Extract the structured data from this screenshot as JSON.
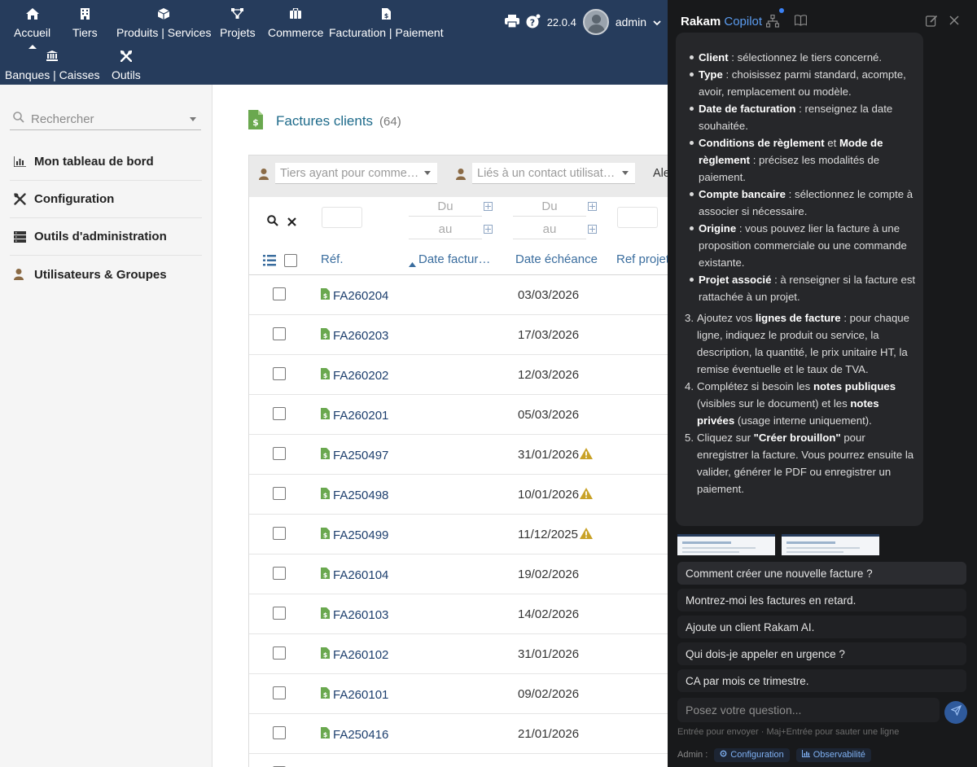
{
  "topnav": {
    "items": [
      {
        "label": "Accueil",
        "icon": "home-icon"
      },
      {
        "label": "Tiers",
        "icon": "building-icon"
      },
      {
        "label": "Produits | Services",
        "icon": "cube-icon"
      },
      {
        "label": "Projets",
        "icon": "project-icon"
      },
      {
        "label": "Commerce",
        "icon": "briefcase-icon"
      },
      {
        "label": "Facturation | Paiement",
        "icon": "invoice-icon"
      },
      {
        "label": "Banques | Caisses",
        "icon": "bank-icon"
      },
      {
        "label": "Outils",
        "icon": "tools-icon"
      }
    ],
    "version": "22.0.4",
    "user": "admin"
  },
  "sidebar": {
    "search_placeholder": "Rechercher",
    "items": [
      {
        "label": "Mon tableau de bord",
        "icon": "chart-bar-icon"
      },
      {
        "label": "Configuration",
        "icon": "tools-icon"
      },
      {
        "label": "Outils d'administration",
        "icon": "server-icon"
      },
      {
        "label": "Utilisateurs & Groupes",
        "icon": "user-icon"
      }
    ]
  },
  "main": {
    "title": "Factures clients",
    "count": "(64)",
    "filters": {
      "tiers_placeholder": "Tiers ayant pour comme…",
      "contact_placeholder": "Liés à un contact utilisat…",
      "extra_label": "Ale",
      "date_from": "Du",
      "date_to": "au"
    },
    "columns": {
      "ref": "Réf.",
      "date": "Date factur…",
      "due": "Date échéance",
      "project": "Ref projet"
    },
    "rows": [
      {
        "ref": "FA260204",
        "due": "03/03/2026",
        "late": false
      },
      {
        "ref": "FA260203",
        "due": "17/03/2026",
        "late": false
      },
      {
        "ref": "FA260202",
        "due": "12/03/2026",
        "late": false
      },
      {
        "ref": "FA260201",
        "due": "05/03/2026",
        "late": false
      },
      {
        "ref": "FA250497",
        "due": "31/01/2026",
        "late": true
      },
      {
        "ref": "FA250498",
        "due": "10/01/2026",
        "late": true
      },
      {
        "ref": "FA250499",
        "due": "11/12/2025",
        "late": true
      },
      {
        "ref": "FA260104",
        "due": "19/02/2026",
        "late": false
      },
      {
        "ref": "FA260103",
        "due": "14/02/2026",
        "late": false
      },
      {
        "ref": "FA260102",
        "due": "31/01/2026",
        "late": false
      },
      {
        "ref": "FA260101",
        "due": "09/02/2026",
        "late": false
      },
      {
        "ref": "FA250416",
        "due": "21/01/2026",
        "late": false
      }
    ]
  },
  "copilot": {
    "title_brand": "Rakam",
    "title_accent": "Copilot",
    "bullets": [
      {
        "term": "Client",
        "text": " : sélectionnez le tiers concerné."
      },
      {
        "term": "Type",
        "text": " : choisissez parmi standard, acompte, avoir, remplacement ou modèle."
      },
      {
        "term": "Date de facturation",
        "text": " : renseignez la date souhaitée."
      },
      {
        "term": "Conditions de règlement",
        "mid": " et ",
        "term2": "Mode de règlement",
        "text": " : précisez les modalités de paiement."
      },
      {
        "term": "Compte bancaire",
        "text": " : sélectionnez le compte à associer si nécessaire."
      },
      {
        "term": "Origine",
        "text": " : vous pouvez lier la facture à une proposition commerciale ou une commande existante."
      },
      {
        "term": "Projet associé",
        "text": " : à renseigner si la facture est rattachée à un projet."
      }
    ],
    "steps": [
      {
        "num": "3.",
        "pre": "Ajoutez vos ",
        "term": "lignes de facture",
        "text": " : pour chaque ligne, indiquez le produit ou service, la description, la quantité, le prix unitaire HT, la remise éventuelle et le taux de TVA."
      },
      {
        "num": "4.",
        "pre": "Complétez si besoin les ",
        "term": "notes publiques",
        "mid": " (visibles sur le document) et les ",
        "term2": "notes privées",
        "text": " (usage interne uniquement)."
      },
      {
        "num": "5.",
        "pre": "Cliquez sur ",
        "term": "\"Créer brouillon\"",
        "text": " pour enregistrer la facture. Vous pourrez ensuite la valider, générer le PDF ou enregistrer un paiement."
      }
    ],
    "suggestions": [
      "Comment créer une nouvelle facture ?",
      "Montrez-moi les factures en retard.",
      "Ajoute un client Rakam AI.",
      "Qui dois-je appeler en urgence ?",
      "CA par mois ce trimestre."
    ],
    "input_placeholder": "Posez votre question...",
    "hint": "Entrée pour envoyer · Maj+Entrée pour sauter une ligne",
    "admin_label": "Admin :",
    "chip_config": "Configuration",
    "chip_obs": "Observabilité"
  }
}
